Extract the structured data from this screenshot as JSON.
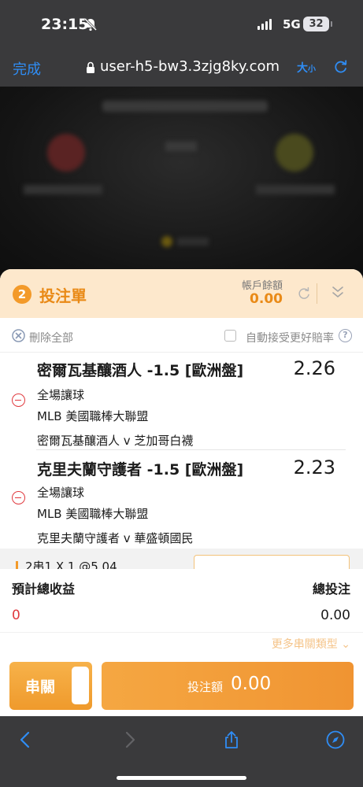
{
  "status_bar": {
    "time": "23:15",
    "network": "5G",
    "battery": "32"
  },
  "browser": {
    "done_label": "完成",
    "url": "user-h5-bw3.3zjg8ky.com",
    "text_size_label": "大",
    "text_size_small": "小"
  },
  "bet_slip": {
    "count": "2",
    "title": "投注單",
    "balance_label": "帳戶餘額",
    "balance_value": "0.00",
    "clear_all_label": "刪除全部",
    "auto_accept_label": "自動接受更好賠率",
    "help_glyph": "?",
    "bets": [
      {
        "title": "密爾瓦基釀酒人 -1.5 [歐洲盤]",
        "odds": "2.26",
        "market": "全場讓球",
        "league": "MLB 美國職棒大聯盟",
        "match": "密爾瓦基釀酒人 v 芝加哥白襪"
      },
      {
        "title": "克里夫蘭守護者 -1.5 [歐洲盤]",
        "odds": "2.23",
        "market": "全場讓球",
        "league": "MLB 美國職棒大聯盟",
        "match": "克里夫蘭守護者 v 華盛頓國民"
      }
    ],
    "parlay_line": "2串1 X 1 @5.04",
    "est_return_label": "預計總收益",
    "est_return_value": "0",
    "total_stake_label": "總投注",
    "total_stake_value": "0.00",
    "more_types_label": "更多串關類型 ⌄",
    "parlay_button_label": "串關",
    "bet_button_label": "投注額",
    "bet_button_amount": "0.00"
  },
  "colors": {
    "accent": "#f39a2a",
    "header_bg": "#fde8cc",
    "ios_blue": "#2f8df5",
    "remove_red": "#e0393e"
  }
}
